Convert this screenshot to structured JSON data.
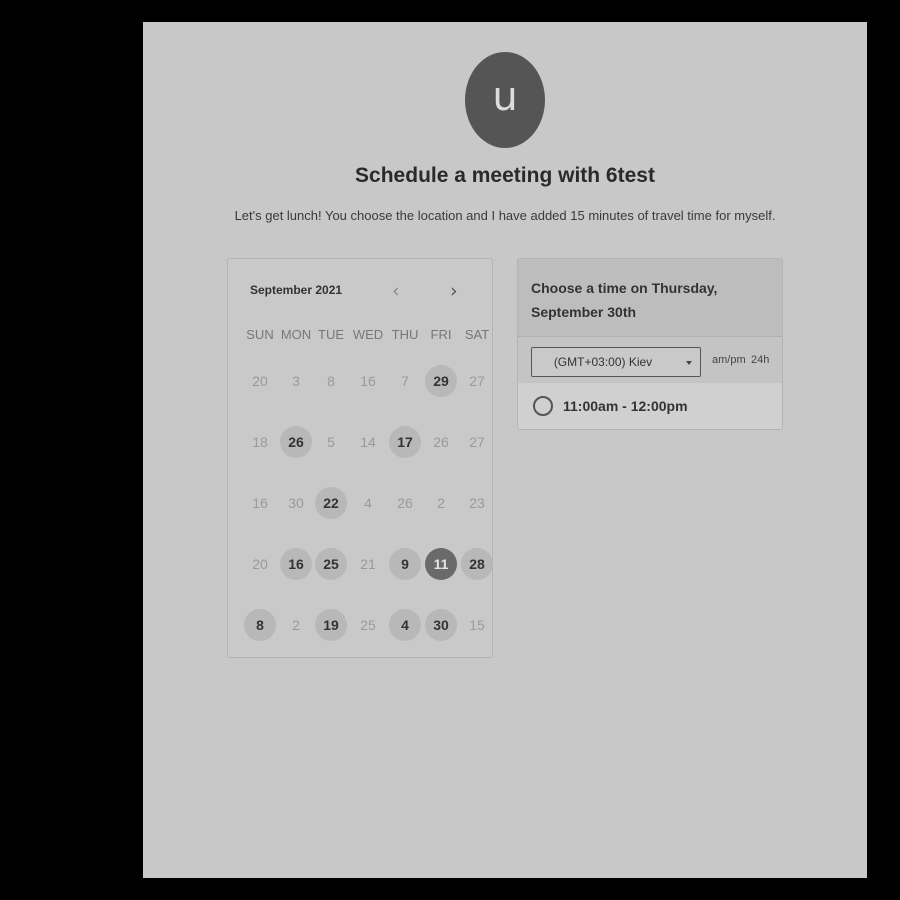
{
  "host": {
    "avatar_initial": "u",
    "title": "Schedule a meeting with 6test",
    "description": "Let's get lunch! You choose the location and I have added 15 minutes of travel time for myself."
  },
  "calendar": {
    "month_label": "September 2021",
    "prev_icon": "chevron-left-icon",
    "next_icon": "chevron-right-icon",
    "weekdays": [
      "SUN",
      "MON",
      "TUE",
      "WED",
      "THU",
      "FRI",
      "SAT"
    ],
    "weeks": [
      [
        {
          "d": "20"
        },
        {
          "d": "3"
        },
        {
          "d": "8"
        },
        {
          "d": "16"
        },
        {
          "d": "7"
        },
        {
          "d": "29",
          "avail": true
        },
        {
          "d": "27"
        }
      ],
      [
        {
          "d": "18"
        },
        {
          "d": "26",
          "avail": true
        },
        {
          "d": "5"
        },
        {
          "d": "14"
        },
        {
          "d": "17",
          "avail": true
        },
        {
          "d": "26"
        },
        {
          "d": "27"
        }
      ],
      [
        {
          "d": "16"
        },
        {
          "d": "30"
        },
        {
          "d": "22",
          "avail": true
        },
        {
          "d": "4"
        },
        {
          "d": "26"
        },
        {
          "d": "2"
        },
        {
          "d": "23"
        }
      ],
      [
        {
          "d": "20"
        },
        {
          "d": "16",
          "avail": true
        },
        {
          "d": "25",
          "avail": true
        },
        {
          "d": "21"
        },
        {
          "d": "9",
          "avail": true
        },
        {
          "d": "11",
          "selected": true
        },
        {
          "d": "28",
          "avail": true
        }
      ],
      [
        {
          "d": "8",
          "avail": true
        },
        {
          "d": "2"
        },
        {
          "d": "19",
          "avail": true
        },
        {
          "d": "25"
        },
        {
          "d": "4",
          "avail": true
        },
        {
          "d": "30",
          "avail": true
        },
        {
          "d": "15"
        }
      ]
    ]
  },
  "time_panel": {
    "heading": "Choose a time on Thursday, September 30th",
    "timezone": "(GMT+03:00) Kiev",
    "format_ampm": "am/pm",
    "format_24h": "24h",
    "slots": [
      "11:00am - 12:00pm"
    ]
  }
}
